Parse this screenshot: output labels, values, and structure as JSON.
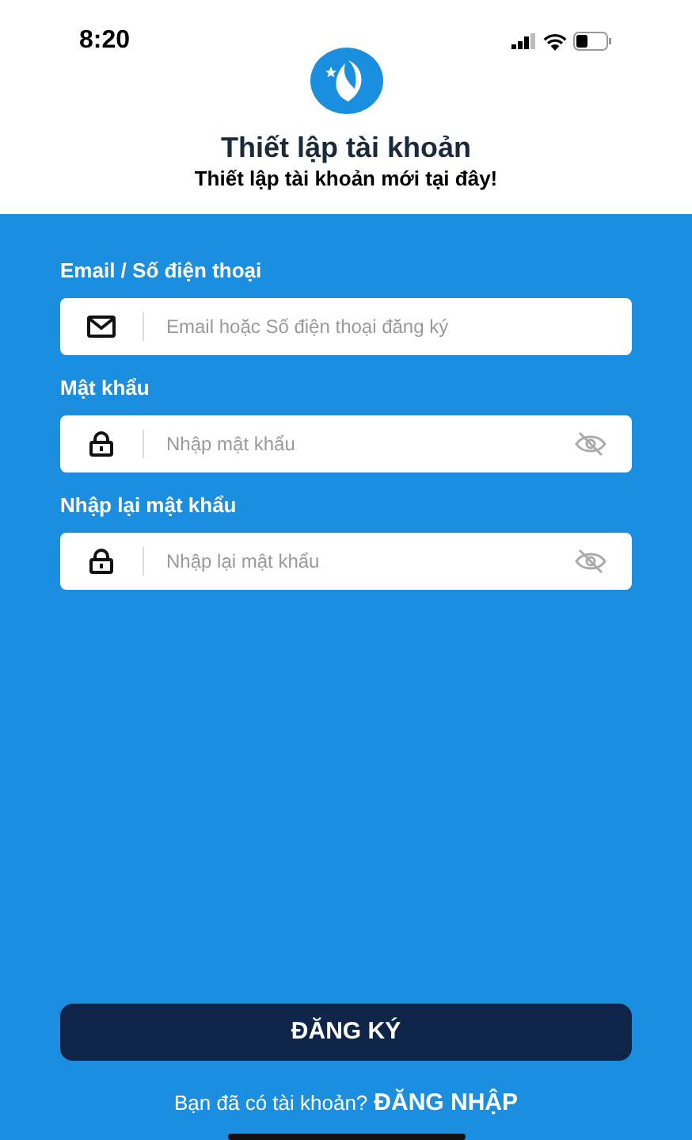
{
  "status_bar": {
    "time": "8:20"
  },
  "header": {
    "title": "Thiết lập tài khoản",
    "subtitle": "Thiết lập tài khoản mới tại đây!"
  },
  "fields": [
    {
      "kind": "email",
      "label": "Email / Số điện thoại",
      "placeholder": "Email hoặc Số điện thoại đăng ký"
    },
    {
      "kind": "password",
      "label": "Mật khẩu",
      "placeholder": "Nhập mật khẩu"
    },
    {
      "kind": "password",
      "label": "Nhập lại mật khẩu",
      "placeholder": "Nhập lại mật khẩu"
    }
  ],
  "submit_button": "ĐĂNG KÝ",
  "footer": {
    "prompt": "Bạn đã có tài khoản?",
    "link": "ĐĂNG NHẬP"
  }
}
